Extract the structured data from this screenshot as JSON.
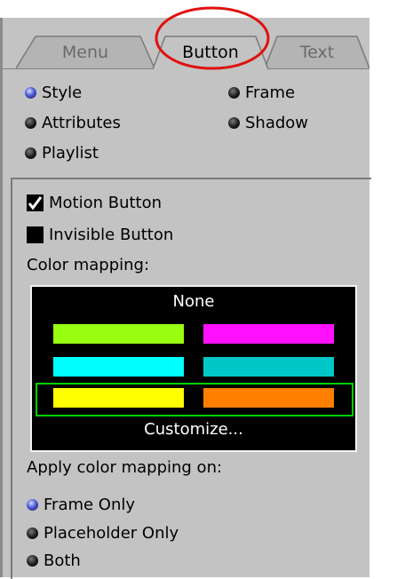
{
  "tabs": [
    {
      "label": "Menu",
      "active": false
    },
    {
      "label": "Button",
      "active": true
    },
    {
      "label": "Text",
      "active": false
    }
  ],
  "properties": {
    "items": [
      {
        "label": "Style",
        "selected": true
      },
      {
        "label": "Frame",
        "selected": false
      },
      {
        "label": "Attributes",
        "selected": false
      },
      {
        "label": "Shadow",
        "selected": false
      },
      {
        "label": "Playlist",
        "selected": false
      }
    ]
  },
  "options": {
    "motion_button": {
      "label": "Motion Button",
      "checked": true
    },
    "invisible_button": {
      "label": "Invisible Button",
      "checked": false
    }
  },
  "color_mapping": {
    "heading": "Color mapping:",
    "none_label": "None",
    "customize_label": "Customize...",
    "rows": [
      [
        "#99ff11",
        "#ff11ff"
      ],
      [
        "#00ffff",
        "#00c8c8"
      ],
      [
        "#ffff00",
        "#ff7f00"
      ]
    ],
    "selected_row": 3
  },
  "apply_on": {
    "heading": "Apply color mapping on:",
    "options": [
      {
        "label": "Frame Only",
        "selected": true
      },
      {
        "label": "Placeholder Only",
        "selected": false
      },
      {
        "label": "Both",
        "selected": false
      }
    ]
  },
  "colors": {
    "panel": "#c3c3c3",
    "selection_outline": "#00d000",
    "annotation": "#e01010"
  }
}
